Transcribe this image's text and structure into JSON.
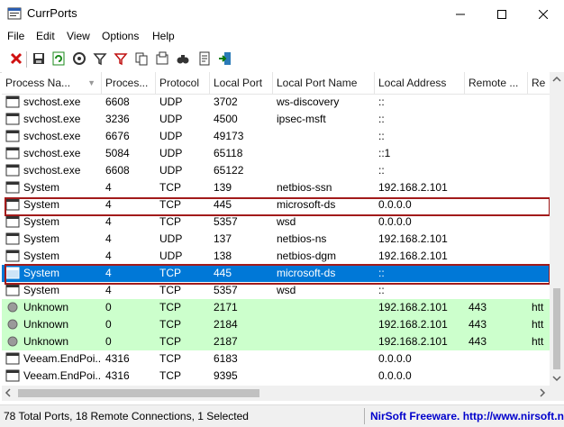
{
  "window": {
    "title": "CurrPorts"
  },
  "menu": [
    "File",
    "Edit",
    "View",
    "Options",
    "Help"
  ],
  "toolbar": [
    "close-connection-icon",
    "save-icon",
    "refresh-icon",
    "properties-icon",
    "filter-icon",
    "advanced-filter-icon",
    "copy-icon",
    "html-report-icon",
    "find-icon",
    "report-icon",
    "exit-icon"
  ],
  "columns": [
    "Process Na...",
    "Proces...",
    "Protocol",
    "Local Port",
    "Local Port Name",
    "Local Address",
    "Remote ...",
    "Re"
  ],
  "sorted_column": 0,
  "rows": [
    {
      "icon": "window",
      "process": "svchost.exe",
      "pid": "6608",
      "protocol": "UDP",
      "local_port": "3702",
      "port_name": "ws-discovery",
      "local_address": "::",
      "remote_port": "",
      "remote": ""
    },
    {
      "icon": "window",
      "process": "svchost.exe",
      "pid": "3236",
      "protocol": "UDP",
      "local_port": "4500",
      "port_name": "ipsec-msft",
      "local_address": "::",
      "remote_port": "",
      "remote": ""
    },
    {
      "icon": "window",
      "process": "svchost.exe",
      "pid": "6676",
      "protocol": "UDP",
      "local_port": "49173",
      "port_name": "",
      "local_address": "::",
      "remote_port": "",
      "remote": ""
    },
    {
      "icon": "window",
      "process": "svchost.exe",
      "pid": "5084",
      "protocol": "UDP",
      "local_port": "65118",
      "port_name": "",
      "local_address": "::1",
      "remote_port": "",
      "remote": ""
    },
    {
      "icon": "window",
      "process": "svchost.exe",
      "pid": "6608",
      "protocol": "UDP",
      "local_port": "65122",
      "port_name": "",
      "local_address": "::",
      "remote_port": "",
      "remote": ""
    },
    {
      "icon": "window",
      "process": "System",
      "pid": "4",
      "protocol": "TCP",
      "local_port": "139",
      "port_name": "netbios-ssn",
      "local_address": "192.168.2.101",
      "remote_port": "",
      "remote": ""
    },
    {
      "icon": "window",
      "process": "System",
      "pid": "4",
      "protocol": "TCP",
      "local_port": "445",
      "port_name": "microsoft-ds",
      "local_address": "0.0.0.0",
      "remote_port": "",
      "remote": "",
      "highlight": true
    },
    {
      "icon": "window",
      "process": "System",
      "pid": "4",
      "protocol": "TCP",
      "local_port": "5357",
      "port_name": "wsd",
      "local_address": "0.0.0.0",
      "remote_port": "",
      "remote": ""
    },
    {
      "icon": "window",
      "process": "System",
      "pid": "4",
      "protocol": "UDP",
      "local_port": "137",
      "port_name": "netbios-ns",
      "local_address": "192.168.2.101",
      "remote_port": "",
      "remote": ""
    },
    {
      "icon": "window",
      "process": "System",
      "pid": "4",
      "protocol": "UDP",
      "local_port": "138",
      "port_name": "netbios-dgm",
      "local_address": "192.168.2.101",
      "remote_port": "",
      "remote": ""
    },
    {
      "icon": "window",
      "process": "System",
      "pid": "4",
      "protocol": "TCP",
      "local_port": "445",
      "port_name": "microsoft-ds",
      "local_address": "::",
      "remote_port": "",
      "remote": "",
      "selected": true,
      "highlight": true
    },
    {
      "icon": "window",
      "process": "System",
      "pid": "4",
      "protocol": "TCP",
      "local_port": "5357",
      "port_name": "wsd",
      "local_address": "::",
      "remote_port": "",
      "remote": ""
    },
    {
      "icon": "circle",
      "process": "Unknown",
      "pid": "0",
      "protocol": "TCP",
      "local_port": "2171",
      "port_name": "",
      "local_address": "192.168.2.101",
      "remote_port": "443",
      "remote": "htt",
      "green": true
    },
    {
      "icon": "circle",
      "process": "Unknown",
      "pid": "0",
      "protocol": "TCP",
      "local_port": "2184",
      "port_name": "",
      "local_address": "192.168.2.101",
      "remote_port": "443",
      "remote": "htt",
      "green": true
    },
    {
      "icon": "circle",
      "process": "Unknown",
      "pid": "0",
      "protocol": "TCP",
      "local_port": "2187",
      "port_name": "",
      "local_address": "192.168.2.101",
      "remote_port": "443",
      "remote": "htt",
      "green": true
    },
    {
      "icon": "window",
      "process": "Veeam.EndPoi...",
      "pid": "4316",
      "protocol": "TCP",
      "local_port": "6183",
      "port_name": "",
      "local_address": "0.0.0.0",
      "remote_port": "",
      "remote": ""
    },
    {
      "icon": "window",
      "process": "Veeam.EndPoi...",
      "pid": "4316",
      "protocol": "TCP",
      "local_port": "9395",
      "port_name": "",
      "local_address": "0.0.0.0",
      "remote_port": "",
      "remote": ""
    }
  ],
  "status": {
    "summary": "78 Total Ports, 18 Remote Connections, 1 Selected",
    "vendor": "NirSoft Freeware.  http://www.nirsoft.net"
  },
  "colors": {
    "selection": "#0078d7",
    "remote_row": "#ccffcc",
    "highlight_box": "#a21b1b",
    "vendor_link": "#0000cc"
  }
}
